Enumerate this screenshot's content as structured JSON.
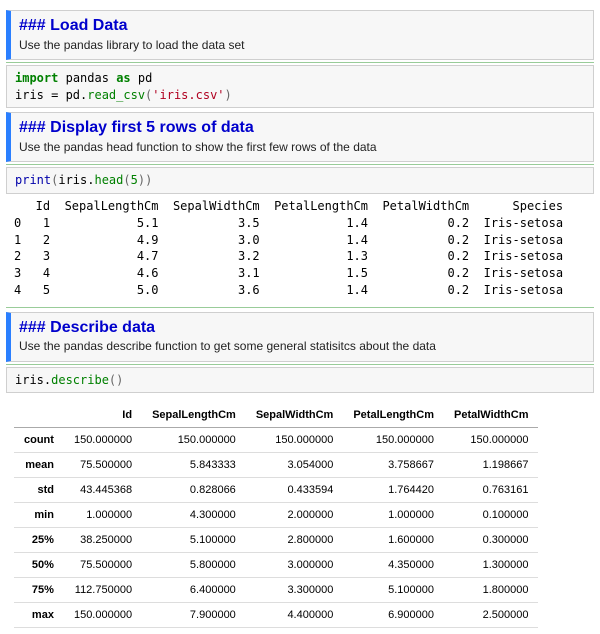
{
  "cells": {
    "load": {
      "heading_raw": "### Load Data",
      "text": "Use the pandas library to load the data set",
      "code": {
        "kw1": "import",
        "mod": "pandas",
        "kw2": "as",
        "alias": "pd",
        "line2a": "iris = pd.",
        "fn": "read_csv",
        "lp": "(",
        "arg": "'iris.csv'",
        "rp": ")"
      }
    },
    "head5": {
      "heading_raw": "### Display first 5 rows of data",
      "text": "Use the pandas head function to show the first few rows of the data",
      "code": {
        "fn1": "print",
        "lp1": "(",
        "mid": "iris.",
        "fn2": "head",
        "lp2": "(",
        "num": "5",
        "rp2": ")",
        "rp1": ")"
      },
      "output": "   Id  SepalLengthCm  SepalWidthCm  PetalLengthCm  PetalWidthCm      Species\n0   1            5.1           3.5            1.4           0.2  Iris-setosa\n1   2            4.9           3.0            1.4           0.2  Iris-setosa\n2   3            4.7           3.2            1.3           0.2  Iris-setosa\n3   4            4.6           3.1            1.5           0.2  Iris-setosa\n4   5            5.0           3.6            1.4           0.2  Iris-setosa"
    },
    "describe": {
      "heading_raw": "### Describe data",
      "text": "Use the pandas describe function to get some general statisitcs about the data",
      "code": {
        "pre": "iris.",
        "fn": "describe",
        "lp": "(",
        "rp": ")"
      },
      "table": {
        "columns": [
          "Id",
          "SepalLengthCm",
          "SepalWidthCm",
          "PetalLengthCm",
          "PetalWidthCm"
        ],
        "rows": [
          {
            "label": "count",
            "vals": [
              "150.000000",
              "150.000000",
              "150.000000",
              "150.000000",
              "150.000000"
            ]
          },
          {
            "label": "mean",
            "vals": [
              "75.500000",
              "5.843333",
              "3.054000",
              "3.758667",
              "1.198667"
            ]
          },
          {
            "label": "std",
            "vals": [
              "43.445368",
              "0.828066",
              "0.433594",
              "1.764420",
              "0.763161"
            ]
          },
          {
            "label": "min",
            "vals": [
              "1.000000",
              "4.300000",
              "2.000000",
              "1.000000",
              "0.100000"
            ]
          },
          {
            "label": "25%",
            "vals": [
              "38.250000",
              "5.100000",
              "2.800000",
              "1.600000",
              "0.300000"
            ]
          },
          {
            "label": "50%",
            "vals": [
              "75.500000",
              "5.800000",
              "3.000000",
              "4.350000",
              "1.300000"
            ]
          },
          {
            "label": "75%",
            "vals": [
              "112.750000",
              "6.400000",
              "3.300000",
              "5.100000",
              "1.800000"
            ]
          },
          {
            "label": "max",
            "vals": [
              "150.000000",
              "7.900000",
              "4.400000",
              "6.900000",
              "2.500000"
            ]
          }
        ]
      }
    }
  }
}
